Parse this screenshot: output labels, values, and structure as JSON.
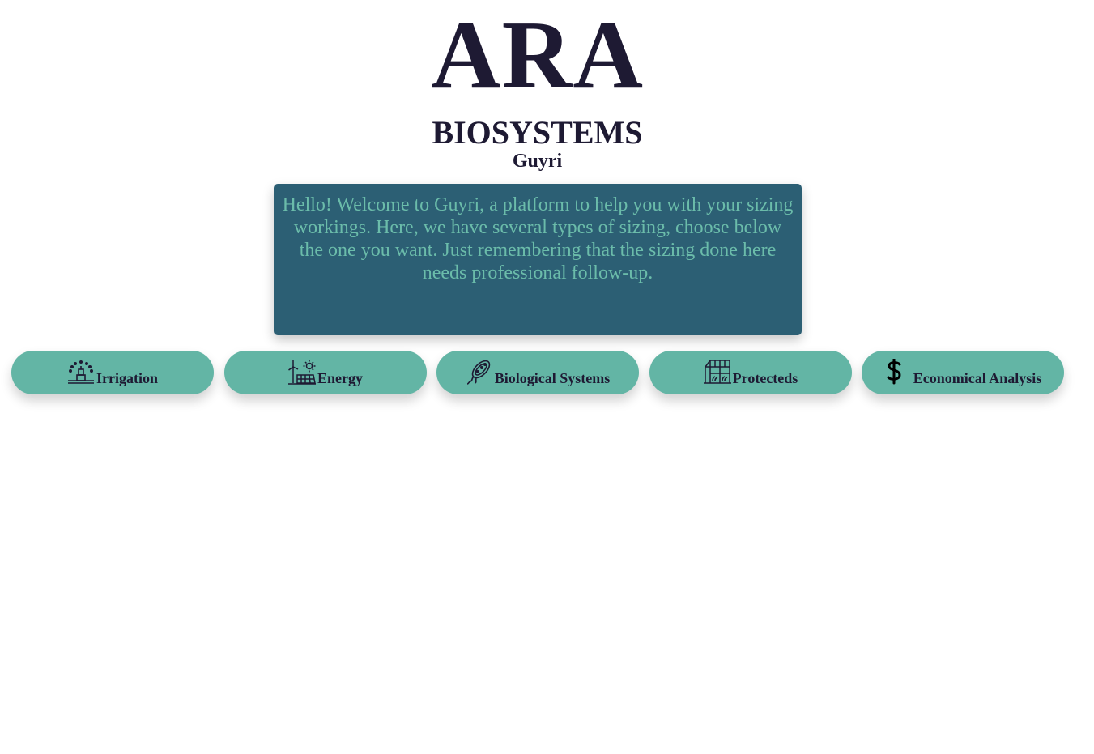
{
  "header": {
    "logo_text": "ARA",
    "subtitle": "BIOSYSTEMS",
    "app_name": "Guyri"
  },
  "welcome": {
    "message": "Hello! Welcome to Guyri, a platform to help you with your sizing workings. Here, we have several types of sizing, choose below the one you want. Just remembering that the sizing done here needs professional follow-up."
  },
  "nav": {
    "items": [
      {
        "label": "Irrigation",
        "icon": "sprinkler-icon"
      },
      {
        "label": "Energy",
        "icon": "wind-solar-icon"
      },
      {
        "label": "Biological Systems",
        "icon": "bacteria-icon"
      },
      {
        "label": "Protecteds",
        "icon": "greenhouse-icon"
      },
      {
        "label": "Economical Analysis",
        "icon": "dollar-icon"
      }
    ]
  },
  "colors": {
    "text": "#1e1a33",
    "card_background": "#2c5f74",
    "card_text": "#6bbcaa",
    "button_background": "#63b5a5"
  }
}
